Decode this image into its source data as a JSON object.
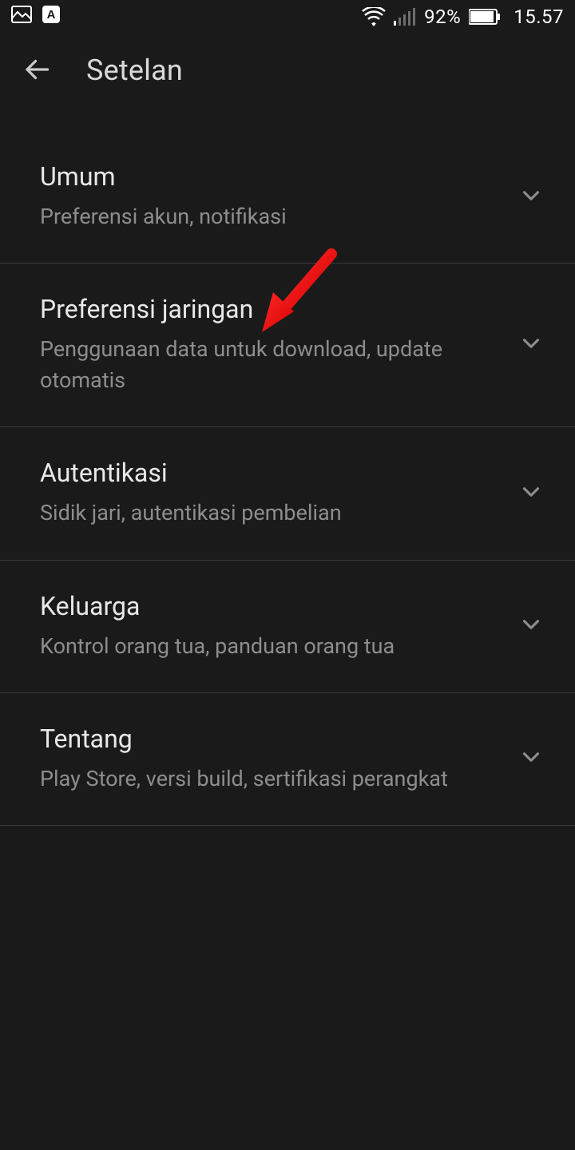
{
  "status": {
    "battery_pct": "92%",
    "clock": "15.57"
  },
  "header": {
    "title": "Setelan"
  },
  "settings": [
    {
      "title": "Umum",
      "subtitle": "Preferensi akun, notifikasi"
    },
    {
      "title": "Preferensi jaringan",
      "subtitle": "Penggunaan data untuk download, update otomatis"
    },
    {
      "title": "Autentikasi",
      "subtitle": "Sidik jari, autentikasi pembelian"
    },
    {
      "title": "Keluarga",
      "subtitle": "Kontrol orang tua, panduan orang tua"
    },
    {
      "title": "Tentang",
      "subtitle": "Play Store, versi build, sertifikasi perangkat"
    }
  ]
}
